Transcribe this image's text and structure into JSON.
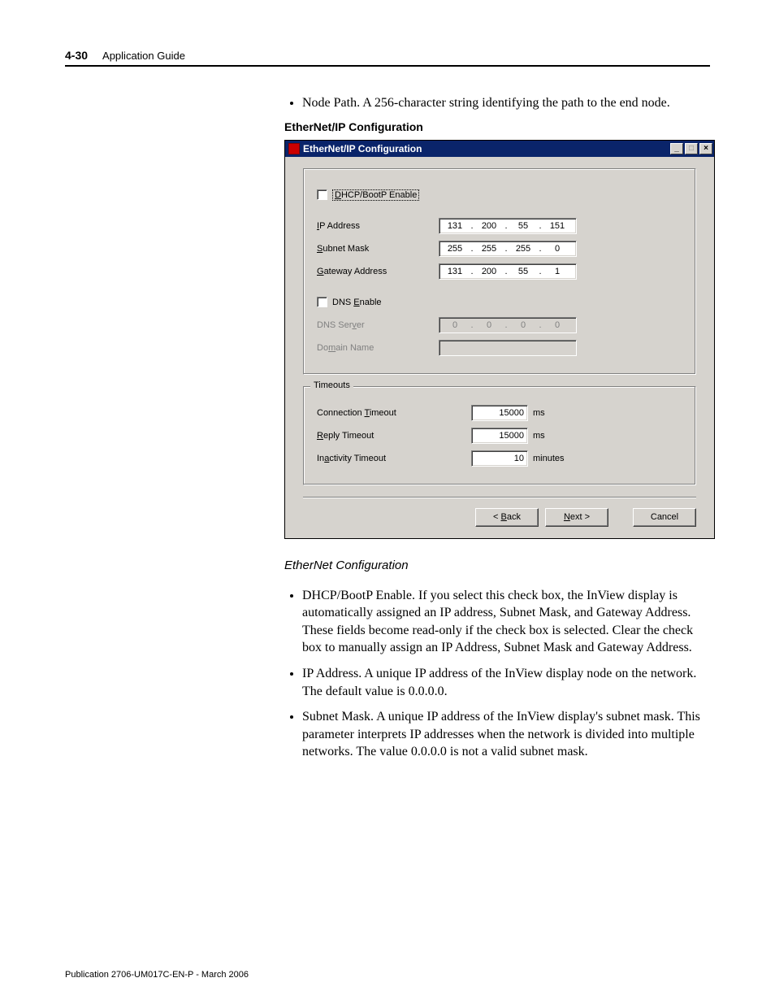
{
  "header": {
    "page_num": "4-30",
    "title": "Application Guide"
  },
  "intro_bullet": "Node Path. A 256-character string identifying the path to the end node.",
  "fig_caption_bold": "EtherNet/IP Configuration",
  "dialog": {
    "title": "EtherNet/IP Configuration",
    "dhcp_label": "DHCP/BootP Enable",
    "ip_label": "IP Address",
    "ip": [
      "131",
      "200",
      "55",
      "151"
    ],
    "subnet_label": "Subnet Mask",
    "subnet": [
      "255",
      "255",
      "255",
      "0"
    ],
    "gateway_label": "Gateway Address",
    "gateway": [
      "131",
      "200",
      "55",
      "1"
    ],
    "dns_enable_label": "DNS Enable",
    "dns_server_label": "DNS Server",
    "dns_server": [
      "0",
      "0",
      "0",
      "0"
    ],
    "domain_label": "Domain Name",
    "domain_value": "",
    "timeouts_legend": "Timeouts",
    "conn_timeout_label": "Connection Timeout",
    "conn_timeout_value": "15000",
    "conn_timeout_unit": "ms",
    "reply_timeout_label": "Reply Timeout",
    "reply_timeout_value": "15000",
    "reply_timeout_unit": "ms",
    "inact_timeout_label": "Inactivity Timeout",
    "inact_timeout_value": "10",
    "inact_timeout_unit": "minutes",
    "back_btn": "< Back",
    "next_btn": "Next >",
    "cancel_btn": "Cancel"
  },
  "fig_caption_ital": "EtherNet Configuration",
  "bullets": [
    "DHCP/BootP Enable. If you select this check box, the InView display is automatically assigned an IP address, Subnet Mask, and Gateway Address. These fields become read-only if the check box is selected. Clear the check box to manually assign an IP Address, Subnet Mask and Gateway Address.",
    "IP Address. A unique IP address of the InView display node on the network. The default value is 0.0.0.0.",
    "Subnet Mask. A unique IP address of the InView display's subnet mask. This parameter interprets IP addresses when the network is divided into multiple networks. The value 0.0.0.0 is not a valid subnet mask."
  ],
  "footer": "Publication 2706-UM017C-EN-P - March 2006"
}
